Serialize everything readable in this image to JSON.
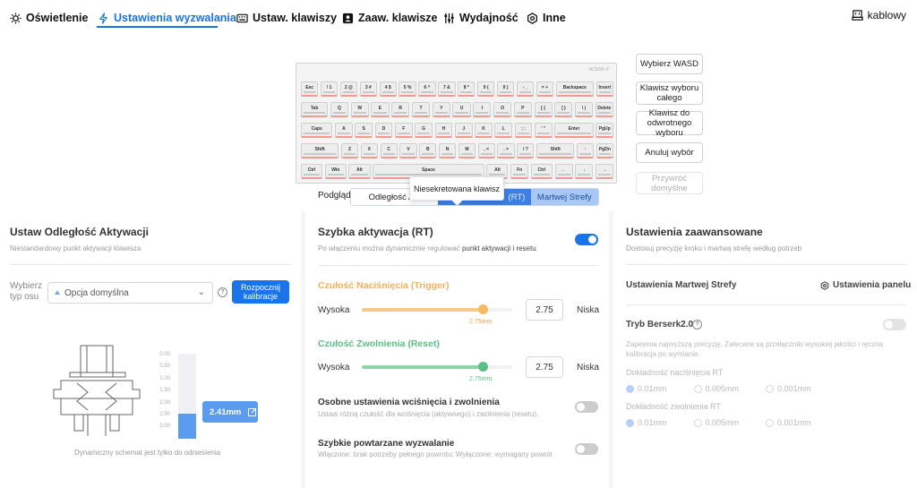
{
  "nav": {
    "items": [
      {
        "label": "Oświetlenie",
        "icon": "sun-icon"
      },
      {
        "label": "Ustawienia wyzwalania",
        "icon": "lightning-icon"
      },
      {
        "label": "Ustaw. klawiszy",
        "icon": "keyboard-icon"
      },
      {
        "label": "Zaaw. klawisze",
        "icon": "user-key-icon"
      },
      {
        "label": "Wydajność",
        "icon": "sliders-icon"
      },
      {
        "label": "Inne",
        "icon": "gear-icon"
      }
    ],
    "connection": "kablowy"
  },
  "keyboard": {
    "brand": "ACER8 ///",
    "rows": [
      [
        "Esc",
        "! 1",
        "2 @",
        "3 #",
        "4 $",
        "5 %",
        "6 ^",
        "7 &",
        "8 *",
        "9 (",
        "0 )",
        "- _",
        "= +",
        "Backspace",
        "Insert"
      ],
      [
        "Tab",
        "Q",
        "W",
        "E",
        "R",
        "T",
        "Y",
        "U",
        "I",
        "O",
        "P",
        "[ {",
        "] }",
        "\\ |",
        "Delete"
      ],
      [
        "Caps",
        "A",
        "S",
        "D",
        "F",
        "G",
        "H",
        "J",
        "K",
        "L",
        "; :",
        "' \"",
        "Enter",
        "PgUp"
      ],
      [
        "Shift",
        "Z",
        "X",
        "C",
        "V",
        "B",
        "N",
        "M",
        ", <",
        ". >",
        "/ ?",
        "Shift",
        "↑",
        "PgDn"
      ],
      [
        "Ctrl",
        "Win",
        "Alt",
        "Space",
        "Alt",
        "Fn",
        "Ctrl",
        "←",
        "↓",
        "→"
      ]
    ]
  },
  "side_buttons": {
    "wasd": "Wybierz WASD",
    "select_all": "Klawisz wyboru całego",
    "select_inverse": "Klawisz do odwrotnego wyboru",
    "cancel": "Anuluj wybór",
    "restore": "Przywróć domyślne"
  },
  "preview": {
    "label": "Podgląd",
    "tabs": [
      "Odległość Akt",
      "(RT)",
      "Martwej Strefy"
    ],
    "tooltip": "Niesekretowana klawisz"
  },
  "panel_activation": {
    "title": "Ustaw Odległość Aktywacji",
    "subtitle": "Niestandardowy punkt aktywacji klawisza",
    "axis_label": "Wybierz typ osu",
    "axis_value": "Opcja domyślna",
    "calibrate": "Rozpocznij kalibracje",
    "scale": [
      "0.00",
      "0.50",
      "1.00",
      "1.50",
      "2.00",
      "2.50",
      "3.00"
    ],
    "value": "2.41mm",
    "value_fraction": 0.3,
    "note": "Dynamiczny schemat jest tylko do odniesienia"
  },
  "panel_rt": {
    "title": "Szybka aktywacja (RT)",
    "subtitle_pre": "Po włączeniu można dynamicznie regulować ",
    "subtitle_bold": "punkt aktywacji i resetu",
    "subtitle_post": ".",
    "enabled": true,
    "trigger_title": "Czułość Naciśnięcia (Trigger)",
    "trigger_high": "Wysoka",
    "trigger_low": "Niska",
    "trigger_value": "2.75",
    "trigger_label": "2.75mm",
    "reset_title": "Czułość Zwolnienia (Reset)",
    "reset_high": "Wysoka",
    "reset_low": "Niska",
    "reset_value": "2.75",
    "reset_label": "2.75mm",
    "separate_title": "Osobne ustawienia wciśnięcia i zwolnienia",
    "separate_desc": "Ustaw różną czułość dla wciśnięcia (aktywnego) i zwolnienia (resetu).",
    "repeat_title": "Szybkie powtarzane wyzwalanie",
    "repeat_desc": "Włączone: brak potrzeby pełnego powrotu; Wyłączone: wymagany powrót"
  },
  "panel_advanced": {
    "title": "Ustawienia zaawansowane",
    "subtitle": "Dostosuj precyzję kroku i martwą strefę według potrzeb",
    "deadzone_title": "Ustawienia Martwej Strefy",
    "panel_settings": "Ustawienia panelu",
    "berserk_title": "Tryb Berserk2.0",
    "berserk_desc": "Zapewnia najwyższą precyzję. Zalecane są przełączniki wysokiej jakości i ręczna kalibracja po wymianie.",
    "press_label": "Dokładność naciśnięcia RT",
    "release_label": "Dokładność zwolnienia RT",
    "options": [
      "0.01mm",
      "0.005mm",
      "0.001mm"
    ]
  }
}
